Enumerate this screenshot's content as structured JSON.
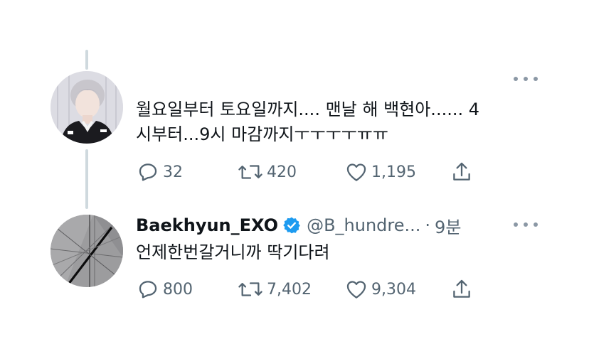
{
  "tweets": [
    {
      "avatar_icon": "user-photo-avatar",
      "text_line1": "월요일부터 토요일까지.... 맨날 해 백현아...... 4",
      "text_line2": "시부터...9시 마감까지ㅜㅜㅜㅜㅠㅠ",
      "more_icon": "more-options-icon",
      "stats": {
        "replies": "32",
        "retweets": "420",
        "likes": "1,195"
      }
    },
    {
      "avatar_icon": "exo-logo-avatar",
      "author_name": "Baekhyun_EXO",
      "verified_icon": "verified-badge-icon",
      "handle": "@B_hundre...",
      "separator": "·",
      "time": "9분",
      "more_icon": "more-options-icon",
      "text": "언제한번갈거니까 딱기다려",
      "stats": {
        "replies": "800",
        "retweets": "7,402",
        "likes": "9,304"
      }
    }
  ],
  "colors": {
    "text": "#0f1419",
    "secondary": "#536471",
    "thread_line": "#cfd9de",
    "verified": "#1d9bf0"
  }
}
